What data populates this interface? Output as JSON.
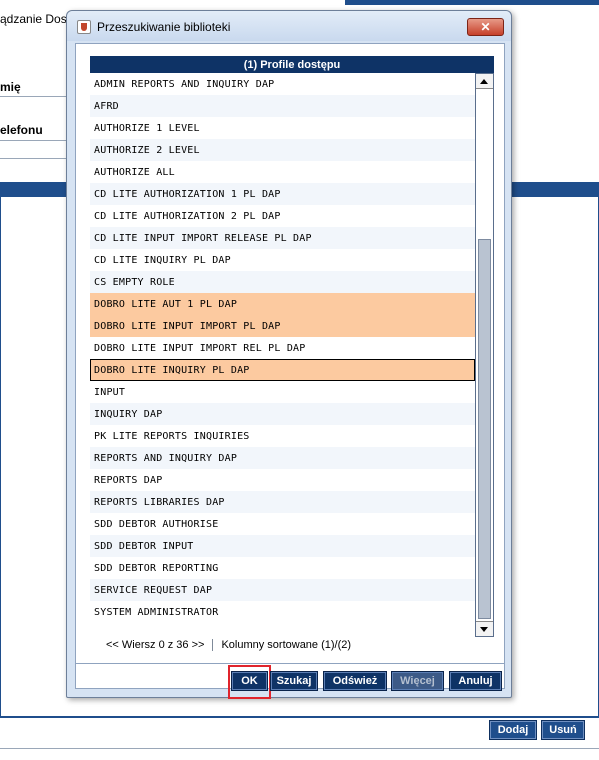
{
  "background": {
    "title": "ądzanie Dos",
    "labels": [
      "mię",
      "elefonu"
    ],
    "buttons": {
      "add": "Dodaj",
      "remove": "Usuń"
    }
  },
  "dialog": {
    "title": "Przeszukiwanie biblioteki",
    "close_symbol": "✕",
    "table": {
      "header": "(1) Profile dostępu",
      "rows": [
        "ADMIN REPORTS AND INQUIRY DAP",
        "AFRD",
        "AUTHORIZE 1 LEVEL",
        "AUTHORIZE 2 LEVEL",
        "AUTHORIZE ALL",
        "CD LITE AUTHORIZATION 1 PL DAP",
        "CD LITE AUTHORIZATION 2 PL DAP",
        "CD LITE INPUT IMPORT RELEASE PL DAP",
        "CD LITE INQUIRY PL DAP",
        "CS EMPTY ROLE",
        "DOBRO LITE AUT 1 PL DAP",
        "DOBRO LITE INPUT IMPORT PL DAP",
        "DOBRO LITE INPUT IMPORT REL PL DAP",
        "DOBRO LITE INQUIRY PL DAP",
        "INPUT",
        "INQUIRY DAP",
        "PK LITE REPORTS INQUIRIES",
        "REPORTS AND INQUIRY DAP",
        "REPORTS DAP",
        "REPORTS LIBRARIES DAP",
        "SDD DEBTOR AUTHORISE",
        "SDD DEBTOR INPUT",
        "SDD DEBTOR REPORTING",
        "SERVICE REQUEST DAP",
        "SYSTEM ADMINISTRATOR"
      ],
      "selected_rows": [
        10,
        11,
        13
      ],
      "focused_row": 13
    },
    "status": {
      "row_info": "<< Wiersz 0 z 36 >>",
      "sort_info": "Kolumny sortowane (1)/(2)"
    },
    "buttons": {
      "ok": "OK",
      "search": "Szukaj",
      "refresh": "Odśwież",
      "more": "Więcej",
      "cancel": "Anuluj"
    },
    "colors": {
      "header_bg": "#0e3366",
      "selected_row": "#fccaa0",
      "ok_highlight": "#e0242c"
    }
  }
}
